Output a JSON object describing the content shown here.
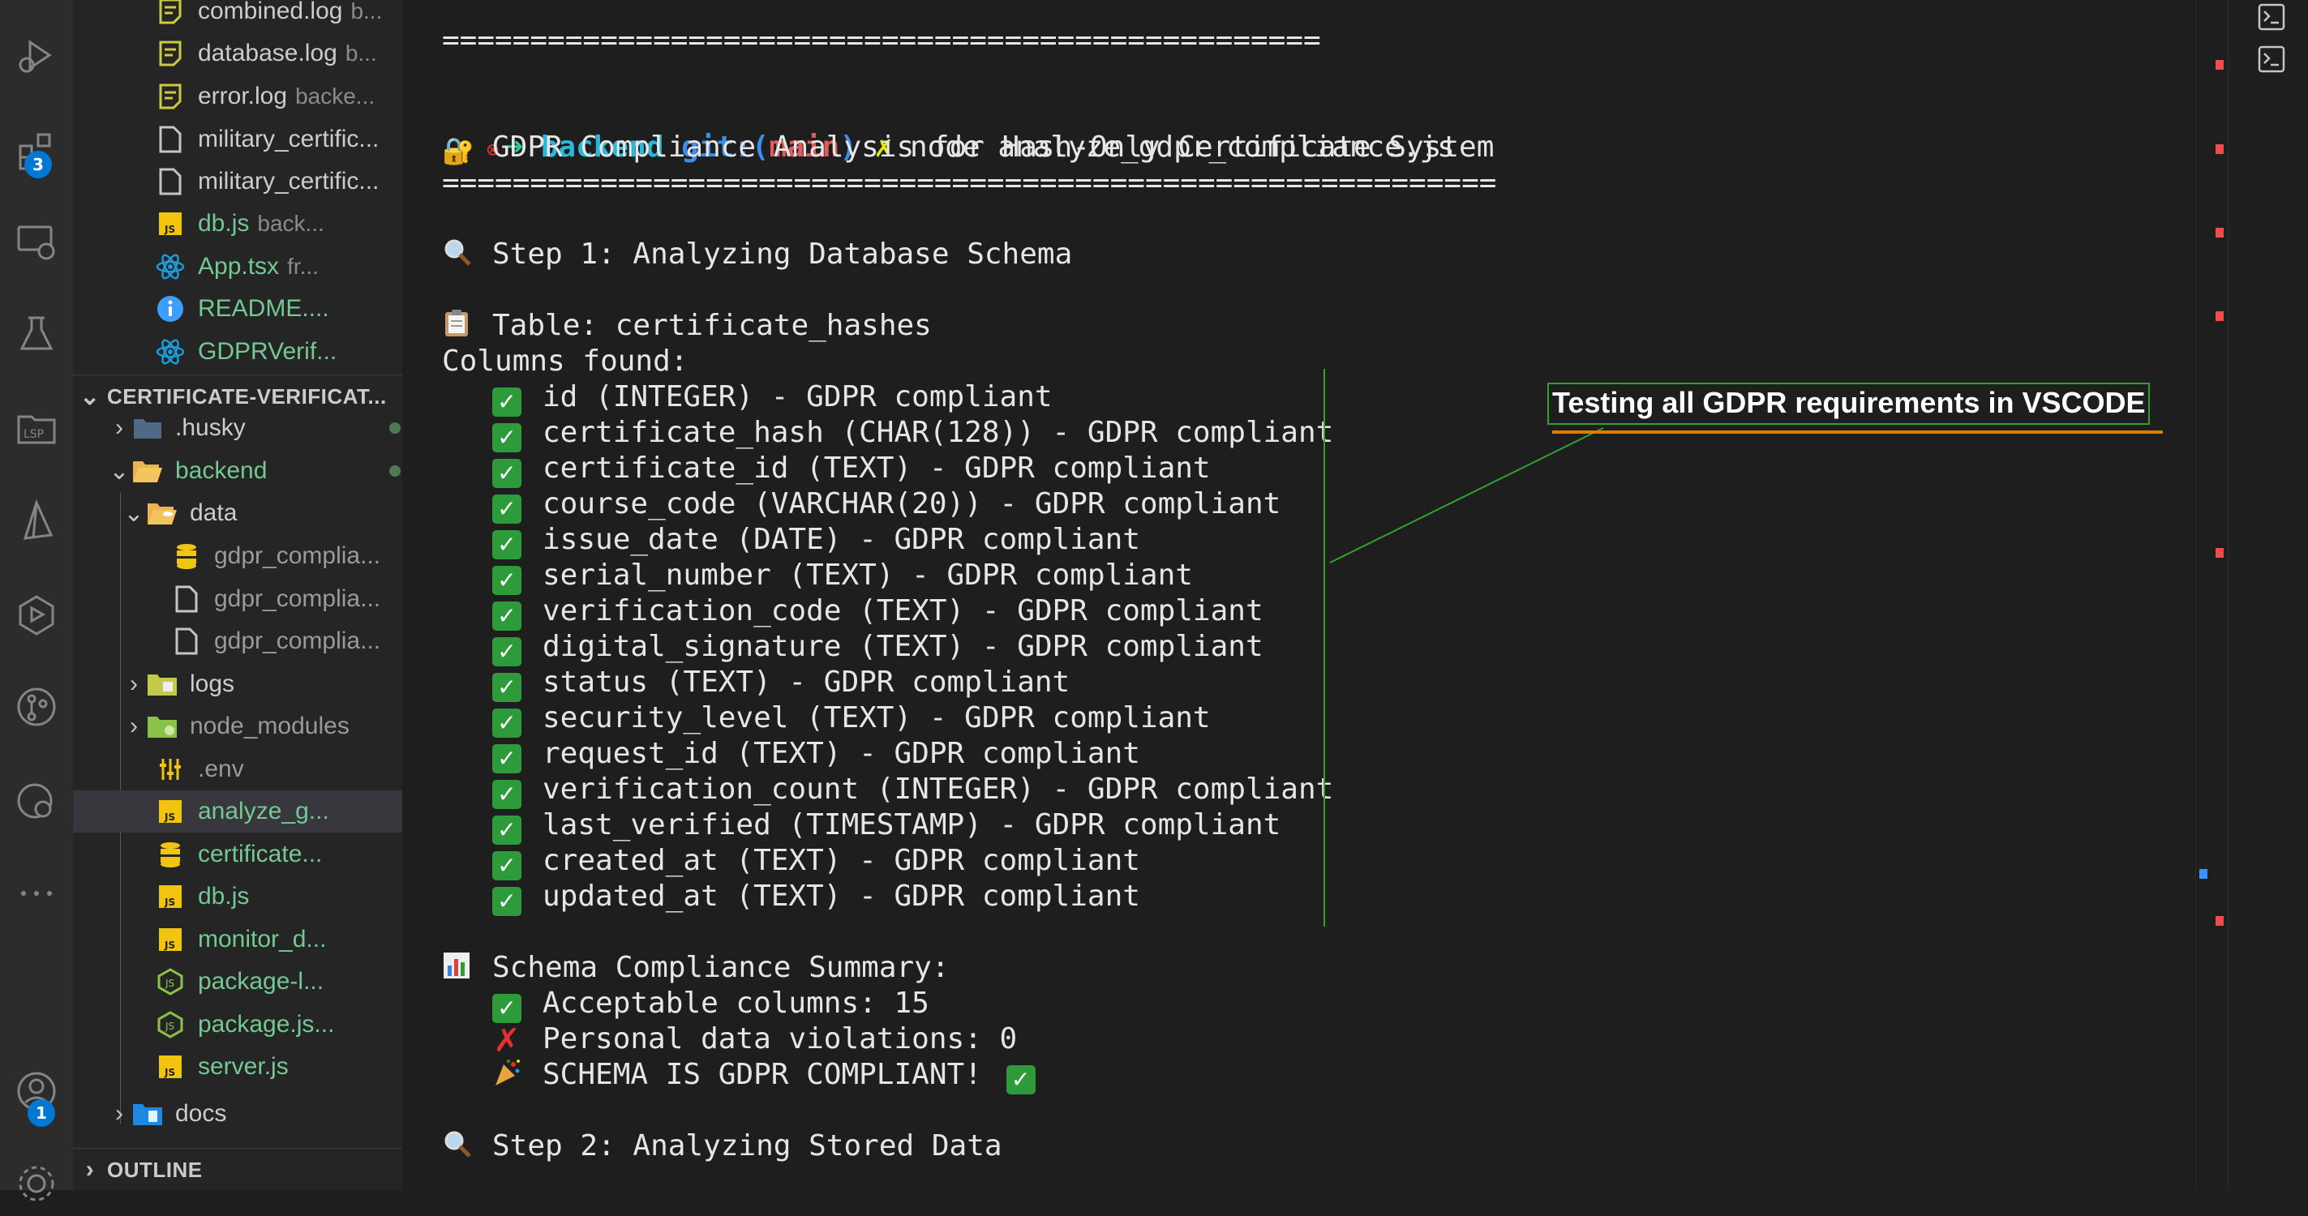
{
  "activity_bar": {
    "extensions_badge": "3",
    "accounts_badge": "1",
    "icons": [
      "run-debug-icon",
      "extensions-icon",
      "remote-explorer-icon",
      "testing-icon",
      "lsp-icon",
      "prisma-icon",
      "docker-icon",
      "source-control-icon",
      "git-graph-icon",
      "more-icon",
      "accounts-icon",
      "settings-icon"
    ]
  },
  "sidebar": {
    "open_editors": [
      {
        "name": "combined.log",
        "desc": "b...",
        "status": ""
      },
      {
        "name": "database.log",
        "desc": "b...",
        "status": ""
      },
      {
        "name": "error.log",
        "desc": "backe...",
        "status": ""
      },
      {
        "name": "military_certific...",
        "desc": "",
        "status": ""
      },
      {
        "name": "military_certific...",
        "desc": "",
        "status": ""
      },
      {
        "name": "db.js",
        "desc": "back...",
        "status": "U"
      },
      {
        "name": "App.tsx",
        "desc": "fr...",
        "status": "U"
      },
      {
        "name": "README....",
        "desc": "",
        "status": "U"
      },
      {
        "name": "GDPRVerif...",
        "desc": "",
        "status": "U"
      }
    ],
    "section_title": "CERTIFICATE-VERIFICAT...",
    "tree": {
      "husky": ".husky",
      "backend": "backend",
      "data": "data",
      "data_files": [
        "gdpr_complia...",
        "gdpr_complia...",
        "gdpr_complia..."
      ],
      "logs": "logs",
      "node_modules": "node_modules",
      "env": ".env",
      "files": [
        {
          "name": "analyze_g...",
          "status": "U"
        },
        {
          "name": "certificate...",
          "status": "U"
        },
        {
          "name": "db.js",
          "status": "U"
        },
        {
          "name": "monitor_d...",
          "status": "U"
        },
        {
          "name": "package-l...",
          "status": "U"
        },
        {
          "name": "package.js...",
          "status": "U"
        },
        {
          "name": "server.js",
          "status": "U"
        }
      ],
      "docs": "docs"
    },
    "outline": "OUTLINE"
  },
  "terminal": {
    "top_rule": "==================================================",
    "prompt": {
      "error_mark": "⊗",
      "arrow": "➜",
      "dir": "backend",
      "git_label": "git:(",
      "branch": "main",
      "git_close": ")",
      "dirty": "✗",
      "command": "node analyze_gdpr_compliance.js"
    },
    "title_emoji": "🔐",
    "title": "GDPR Compliance Analysis for Hash-Only Certificate System",
    "rule": "============================================================",
    "step1": "Step 1: Analyzing Database Schema",
    "table_label": "Table: certificate_hashes",
    "columns_found": "Columns found:",
    "columns": [
      "id (INTEGER) - GDPR compliant",
      "certificate_hash (CHAR(128)) - GDPR compliant",
      "certificate_id (TEXT) - GDPR compliant",
      "course_code (VARCHAR(20)) - GDPR compliant",
      "issue_date (DATE) - GDPR compliant",
      "serial_number (TEXT) - GDPR compliant",
      "verification_code (TEXT) - GDPR compliant",
      "digital_signature (TEXT) - GDPR compliant",
      "status (TEXT) - GDPR compliant",
      "security_level (TEXT) - GDPR compliant",
      "request_id (TEXT) - GDPR compliant",
      "verification_count (INTEGER) - GDPR compliant",
      "last_verified (TIMESTAMP) - GDPR compliant",
      "created_at (TEXT) - GDPR compliant",
      "updated_at (TEXT) - GDPR compliant"
    ],
    "summary_title": "Schema Compliance Summary:",
    "acceptable": "Acceptable columns: 15",
    "violations": "Personal data violations: 0",
    "compliant": "SCHEMA IS GDPR COMPLIANT!",
    "step2": "Step 2: Analyzing Stored Data"
  },
  "annotation": "Testing all GDPR requirements in VSCODE",
  "colors": {
    "accent": "#0078d4",
    "git_untracked": "#73c991",
    "annotation_green": "#2fa12f",
    "annotation_orange": "#e07b00",
    "error_red": "#f14c4c"
  }
}
